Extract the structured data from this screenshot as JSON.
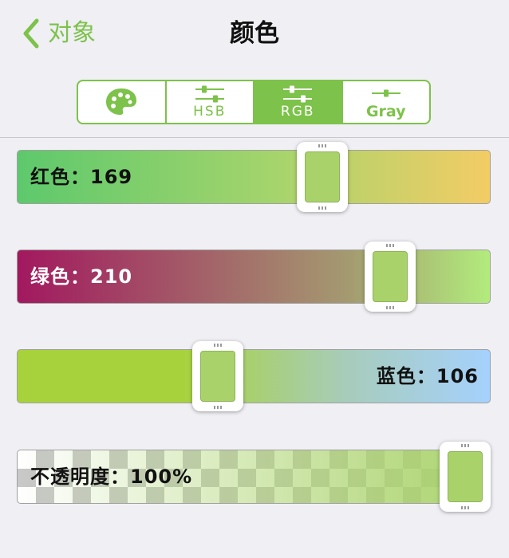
{
  "nav": {
    "back_label": "对象",
    "title": "颜色"
  },
  "tabs": [
    {
      "label": "",
      "icon": "palette-icon",
      "active": false
    },
    {
      "label": "HSB",
      "icon": "sliders-icon",
      "active": false
    },
    {
      "label": "RGB",
      "icon": "sliders-icon",
      "active": true
    },
    {
      "label": "Gray",
      "icon": "slider-icon",
      "active": false
    }
  ],
  "sliders": {
    "red": {
      "label": "红色：169",
      "value": 169,
      "max": 255
    },
    "green": {
      "label": "绿色：210",
      "value": 210,
      "max": 255
    },
    "blue": {
      "label": "蓝色：106",
      "value": 106,
      "max": 255
    },
    "alpha": {
      "label": "不透明度：100%",
      "value": 100,
      "max": 100
    }
  },
  "colors": {
    "accent": "#7dc24a",
    "current": "#a9d26a"
  }
}
